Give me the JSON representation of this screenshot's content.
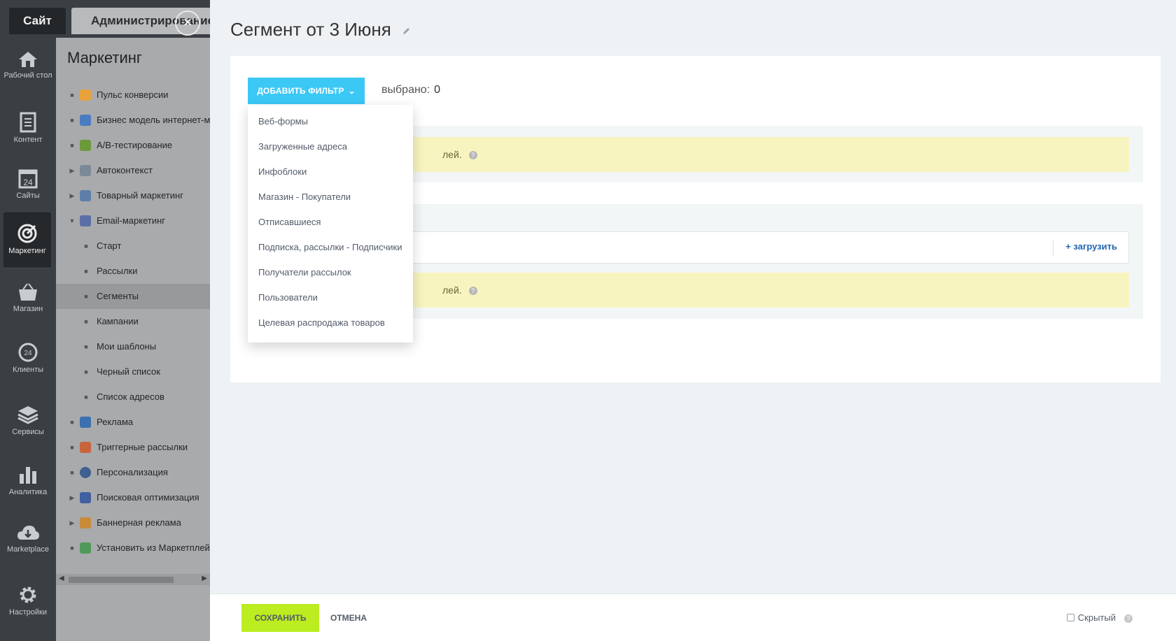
{
  "topbar": {
    "site_tab": "Сайт",
    "admin_tab": "Администрирование"
  },
  "rail": [
    {
      "label": "Рабочий стол",
      "icon": "home-icon"
    },
    {
      "label": "Контент",
      "icon": "document-icon"
    },
    {
      "label": "Сайты",
      "icon": "calendar-24-icon"
    },
    {
      "label": "Маркетинг",
      "icon": "target-icon"
    },
    {
      "label": "Магазин",
      "icon": "basket-icon"
    },
    {
      "label": "Клиенты",
      "icon": "clients-24-icon"
    },
    {
      "label": "Сервисы",
      "icon": "layers-icon"
    },
    {
      "label": "Аналитика",
      "icon": "bar-chart-icon"
    },
    {
      "label": "Marketplace",
      "icon": "cloud-download-icon"
    },
    {
      "label": "Настройки",
      "icon": "gear-icon"
    }
  ],
  "menu": {
    "title": "Маркетинг",
    "items": [
      {
        "label": "Пульс конверсии",
        "marker": "■"
      },
      {
        "label": "Бизнес модель интернет-маркетинга",
        "marker": "■"
      },
      {
        "label": "A/B-тестирование",
        "marker": "■"
      },
      {
        "label": "Автоконтекст",
        "marker": "▶"
      },
      {
        "label": "Товарный маркетинг",
        "marker": "▶"
      },
      {
        "label": "Email-маркетинг",
        "marker": "▼"
      },
      {
        "label": "Старт",
        "marker": "■"
      },
      {
        "label": "Рассылки",
        "marker": "■"
      },
      {
        "label": "Сегменты",
        "marker": "■"
      },
      {
        "label": "Кампании",
        "marker": "■"
      },
      {
        "label": "Мои шаблоны",
        "marker": "■"
      },
      {
        "label": "Черный список",
        "marker": "■"
      },
      {
        "label": "Список адресов",
        "marker": "■"
      },
      {
        "label": "Реклама",
        "marker": "■"
      },
      {
        "label": "Триггерные рассылки",
        "marker": "■"
      },
      {
        "label": "Персонализация",
        "marker": "■"
      },
      {
        "label": "Поисковая оптимизация",
        "marker": "▶"
      },
      {
        "label": "Баннерная реклама",
        "marker": "▶"
      },
      {
        "label": "Установить из Маркетплейс",
        "marker": "■"
      }
    ]
  },
  "panel": {
    "title": "Сегмент от 3 Июня",
    "add_filter": "ДОБАВИТЬ ФИЛЬТР",
    "selected_label": "выбрано:",
    "selected_count": "0",
    "notice1": "лей.",
    "notice2": "лей.",
    "upload": "+ загрузить"
  },
  "dropdown": {
    "items": [
      "Веб-формы",
      "Загруженные адреса",
      "Инфоблоки",
      "Магазин - Покупатели",
      "Отписавшиеся",
      "Подписка, рассылки - Подписчики",
      "Получатели рассылок",
      "Пользователи",
      "Целевая распродажа товаров"
    ]
  },
  "footer": {
    "save": "СОХРАНИТЬ",
    "cancel": "ОТМЕНА",
    "hidden": "Скрытый"
  },
  "colors": {
    "accent_blue": "#3bc8f5",
    "save_green": "#bbed21",
    "notice_yellow": "#f8f4bf",
    "link_blue": "#2067b0"
  }
}
